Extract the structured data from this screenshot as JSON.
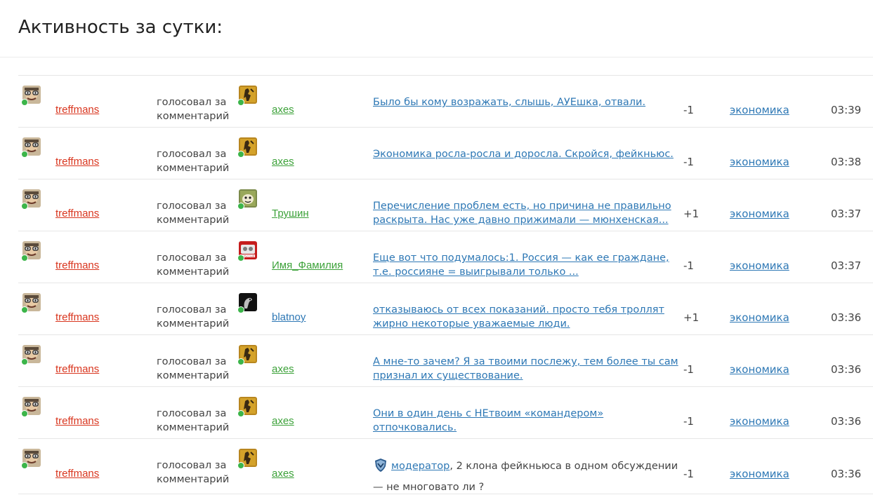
{
  "page_title": "Активность за сутки:",
  "rows": [
    {
      "user": "treffmans",
      "action": "голосовал за комментарий",
      "target": "axes",
      "target_color": "green",
      "target_icon": "axes-avatar",
      "comment": "Было бы кому возражать, слышь, АУЕшка, отвали.",
      "vote": "-1",
      "category": "экономика",
      "time": "03:39"
    },
    {
      "user": "treffmans",
      "action": "голосовал за комментарий",
      "target": "axes",
      "target_color": "green",
      "target_icon": "axes-avatar",
      "comment": "Экономика росла-росла и доросла. Скройся, фейкньюс.",
      "vote": "-1",
      "category": "экономика",
      "time": "03:38"
    },
    {
      "user": "treffmans",
      "action": "голосовал за комментарий",
      "target": "Трушин",
      "target_color": "green",
      "target_icon": "trushin-avatar",
      "comment": "Перечисление проблем есть, но причина не правильно раскрыта. Нас уже давно прижимали — мюнхенская...",
      "vote": "+1",
      "category": "экономика",
      "time": "03:37"
    },
    {
      "user": "treffmans",
      "action": "голосовал за комментарий",
      "target": "Имя_Фамилия",
      "target_color": "green",
      "target_icon": "imya-familiya-avatar",
      "comment": "Еще вот  что подумалось:1. Россия — как  ее граждане, т.е.  россияне = выигрывали  только ...",
      "vote": "-1",
      "category": "экономика",
      "time": "03:37"
    },
    {
      "user": "treffmans",
      "action": "голосовал за комментарий",
      "target": "blatnoy",
      "target_color": "blue",
      "target_icon": "blatnoy-avatar",
      "comment": "отказываюсь от всех показаний. просто тебя троллят жирно некоторые уважаемые люди.",
      "vote": "+1",
      "category": "экономика",
      "time": "03:36"
    },
    {
      "user": "treffmans",
      "action": "голосовал за комментарий",
      "target": "axes",
      "target_color": "green",
      "target_icon": "axes-avatar",
      "comment": "А мне-то зачем? Я за твоими послежу, тем более ты сам признал их существование.",
      "vote": "-1",
      "category": "экономика",
      "time": "03:36"
    },
    {
      "user": "treffmans",
      "action": "голосовал за комментарий",
      "target": "axes",
      "target_color": "green",
      "target_icon": "axes-avatar",
      "comment": "Они в один день с НЕтвоим «командером» отпочковались.",
      "vote": "-1",
      "category": "экономика",
      "time": "03:36"
    },
    {
      "user": "treffmans",
      "action": "голосовал за комментарий",
      "target": "axes",
      "target_color": "green",
      "target_icon": "axes-avatar",
      "comment_moderator": "модератор",
      "comment_rest": ", 2 клона фейкньюса в одном обсуждении — не многовато ли ?",
      "vote": "-1",
      "category": "экономика",
      "time": "03:36"
    }
  ],
  "colors": {
    "username": "#d9361f",
    "link": "#2e78b5",
    "green_user": "#3da23a",
    "online": "#3cb54a"
  }
}
